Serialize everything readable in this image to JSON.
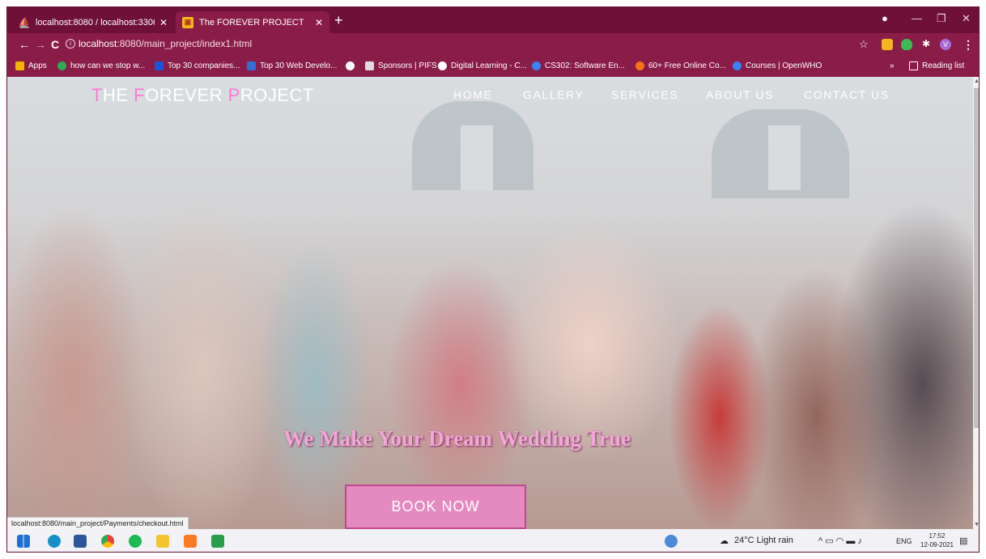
{
  "browser": {
    "tabs": [
      {
        "title": "localhost:8080 / localhost:3306 /",
        "active": false
      },
      {
        "title": "The FOREVER PROJECT",
        "active": true
      }
    ],
    "url_host": "localhost",
    "url_rest": ":8080/main_project/index1.html",
    "bookmarks": [
      {
        "label": "Apps",
        "color": "#f4b400"
      },
      {
        "label": "how can we stop w...",
        "color": "#34a853"
      },
      {
        "label": "Top 30 companies...",
        "color": "#1a56db"
      },
      {
        "label": "Top 30 Web Develo...",
        "color": "#2f6fd6"
      },
      {
        "label": "",
        "color": "#ffffff"
      },
      {
        "label": "Sponsors | PIFS",
        "color": "#dddddd"
      },
      {
        "label": "Digital Learning - C...",
        "color": "#ffffff"
      },
      {
        "label": "CS302: Software En...",
        "color": "#3b82f6"
      },
      {
        "label": "60+ Free Online Co...",
        "color": "#f97316"
      },
      {
        "label": "Courses | OpenWHO",
        "color": "#3b82f6"
      }
    ],
    "reading_list": "Reading list",
    "status_url": "localhost:8080/main_project/Payments/checkout.html"
  },
  "site": {
    "brand": {
      "p1_accent": "T",
      "p1_rest": "HE ",
      "p2_accent": "F",
      "p2_rest": "OREVER ",
      "p3_accent": "P",
      "p3_rest": "ROJECT"
    },
    "nav": [
      "HOME",
      "GALLERY",
      "SERVICES",
      "ABOUT US",
      "CONTACT US"
    ],
    "tagline": "We Make Your Dream Wedding True",
    "cta": "BOOK NOW",
    "accent_color": "#ff78d6",
    "button_color": "#e58ac1"
  },
  "taskbar": {
    "weather": "24°C  Light rain",
    "lang": "ENG",
    "time": "17:52",
    "date": "12-09-2021"
  }
}
